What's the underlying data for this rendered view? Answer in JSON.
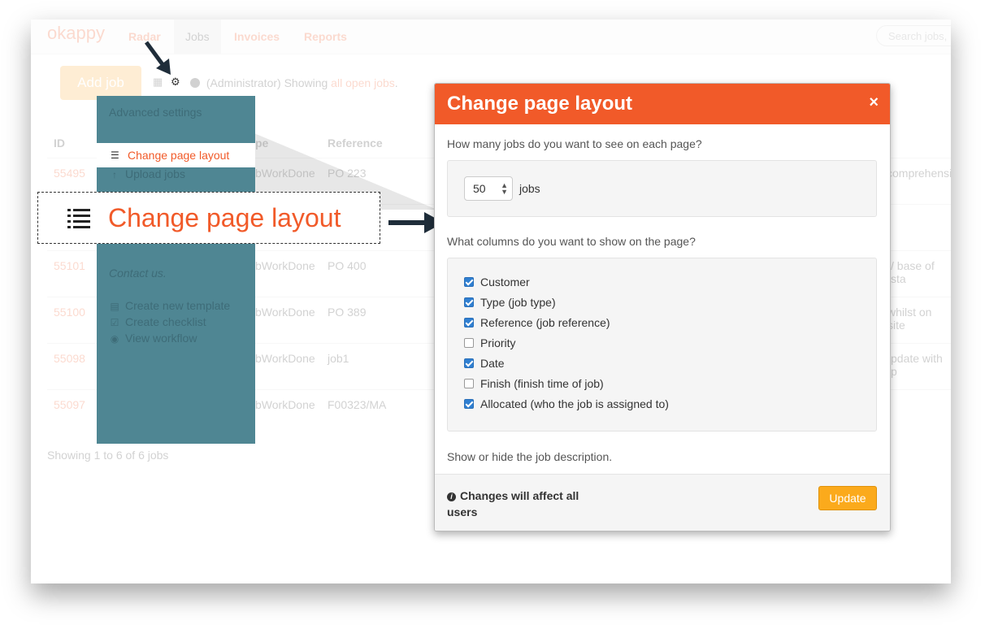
{
  "nav": {
    "logo": "okappy",
    "items": [
      {
        "label": "Radar"
      },
      {
        "label": "Jobs"
      },
      {
        "label": "Invoices"
      },
      {
        "label": "Reports"
      }
    ],
    "search_placeholder": "Search jobs,"
  },
  "toolbar": {
    "add_job": "Add job",
    "showing_prefix": "(Administrator) Showing",
    "showing_link": "all open jobs",
    "showing_suffix": "."
  },
  "table": {
    "headers": [
      "ID",
      "pe",
      "Reference"
    ],
    "rows": [
      {
        "id": "55495",
        "type": "bWorkDone",
        "ref": "PO 223",
        "desc": "comprehensi"
      },
      {
        "id": "55101",
        "type": "bWorkDone",
        "ref": "PO 400",
        "desc": "/ base of sta"
      },
      {
        "id": "55100",
        "type": "bWorkDone",
        "ref": "PO 389",
        "desc": "whilst on site"
      },
      {
        "id": "55098",
        "type": "bWorkDone",
        "ref": "job1",
        "desc": "pdate with p"
      },
      {
        "id": "55097",
        "type": "bWorkDone",
        "ref": "F00323/MA",
        "desc": ""
      }
    ],
    "footer": "Showing 1 to 6 of 6 jobs"
  },
  "menu": {
    "title": "Advanced settings",
    "highlight": "Change page layout",
    "items": [
      {
        "label": "Upload jobs"
      },
      {
        "label": "Create new template"
      },
      {
        "label": "Create checklist"
      },
      {
        "label": "View workflow"
      }
    ],
    "contact": "Contact us."
  },
  "callout": {
    "label": "Change page layout"
  },
  "modal": {
    "title": "Change page layout",
    "close": "×",
    "q_jobs": "How many jobs do you want to see on each page?",
    "jobs_value": "50",
    "jobs_unit": "jobs",
    "q_columns": "What columns do you want to show on the page?",
    "columns": [
      {
        "label": "Customer",
        "checked": true
      },
      {
        "label": "Type (job type)",
        "checked": true
      },
      {
        "label": "Reference (job reference)",
        "checked": true
      },
      {
        "label": "Priority",
        "checked": false
      },
      {
        "label": "Date",
        "checked": true
      },
      {
        "label": "Finish (finish time of job)",
        "checked": false
      },
      {
        "label": "Allocated (who the job is assigned to)",
        "checked": true
      }
    ],
    "q_description": "Show or hide the job description.",
    "footer_note": "Changes will affect all users",
    "update": "Update"
  },
  "colors": {
    "brand": "#f15a29",
    "menu_bg": "#4f8693",
    "update_btn": "#fbaa1c",
    "checkbox": "#2f7fd1"
  }
}
